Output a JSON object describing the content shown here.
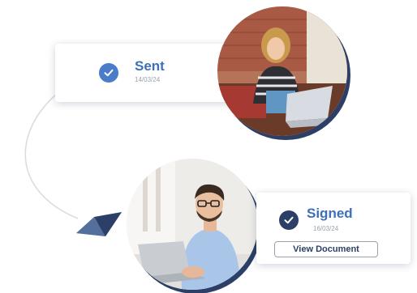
{
  "sent_card": {
    "status": "Sent",
    "date": "14/03/24",
    "icon": "check-circle-icon",
    "icon_color": "#4a7cc9"
  },
  "signed_card": {
    "status": "Signed",
    "date": "16/03/24",
    "icon": "check-circle-icon",
    "icon_color": "#2c3f66",
    "button_label": "View Document"
  },
  "colors": {
    "accent_blue": "#3f6fb8",
    "navy": "#2c3f66"
  },
  "photos": [
    {
      "name": "woman-laptop-photo"
    },
    {
      "name": "man-laptop-photo"
    }
  ],
  "decorations": [
    "flow-curve",
    "paper-plane-icon"
  ]
}
